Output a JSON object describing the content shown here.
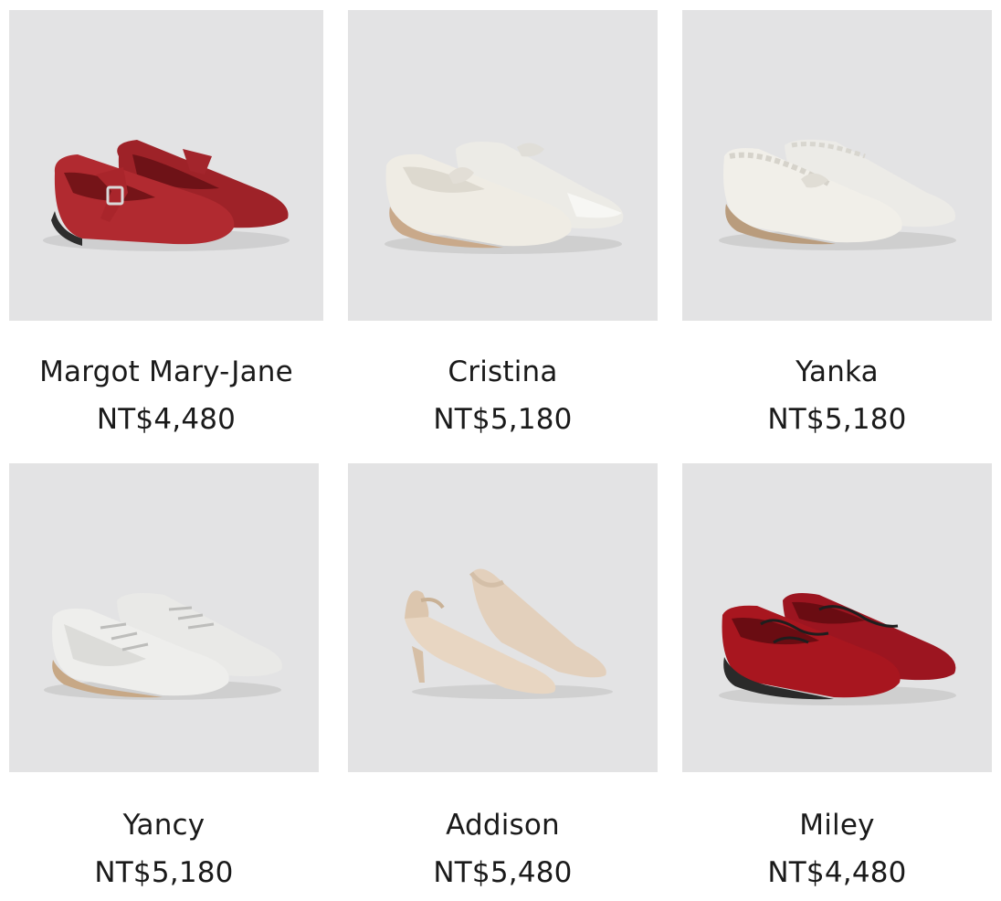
{
  "products": [
    {
      "name": "Margot Mary-Jane",
      "price": "NT$4,480",
      "color": "#b12a30",
      "style": "mary-jane",
      "icon": "red-mary-jane-flats-image"
    },
    {
      "name": "Cristina",
      "price": "NT$5,180",
      "color": "#efece4",
      "style": "bow-flat",
      "icon": "white-bow-ballet-flats-image"
    },
    {
      "name": "Yanka",
      "price": "NT$5,180",
      "color": "#f1efe9",
      "style": "bow-flat",
      "icon": "white-ruched-bow-flats-image"
    },
    {
      "name": "Yancy",
      "price": "NT$5,180",
      "color": "#eeeeec",
      "style": "sneaker",
      "icon": "white-lace-up-sneakers-image"
    },
    {
      "name": "Addison",
      "price": "NT$5,480",
      "color": "#e8d6c2",
      "style": "slingback",
      "icon": "beige-slingback-pumps-image"
    },
    {
      "name": "Miley",
      "price": "NT$4,480",
      "color": "#a8161f",
      "style": "lace-flat",
      "icon": "red-lace-up-ballet-flats-image"
    }
  ]
}
